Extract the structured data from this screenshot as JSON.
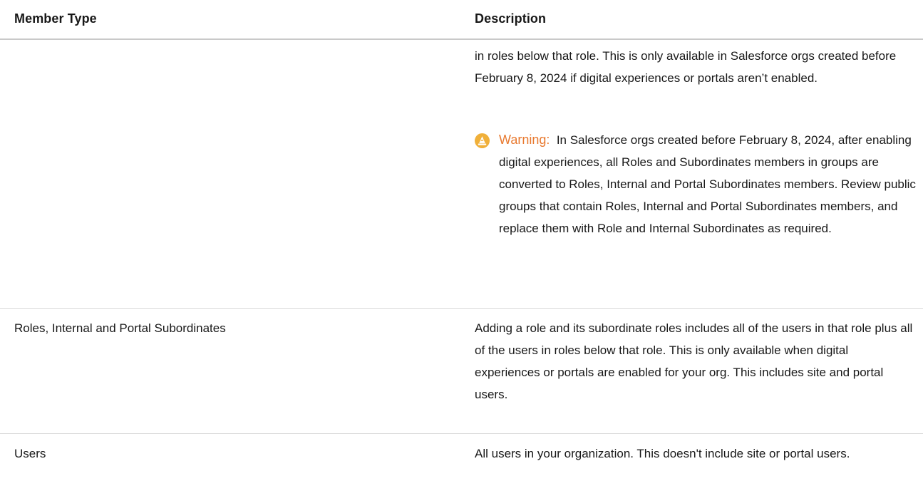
{
  "table": {
    "headers": {
      "member_type": "Member Type",
      "description": "Description"
    },
    "rows": [
      {
        "member_type": "",
        "description": "in roles below that role. This is only available in Salesforce orgs created before February 8, 2024 if digital experiences or portals aren’t enabled.",
        "warning": {
          "icon": "warning-icon",
          "label": "Warning:",
          "text": "In Salesforce orgs created before February 8, 2024, after enabling digital experiences, all Roles and Subordinates members in groups are converted to Roles, Internal and Portal Subordinates members. Review public groups that contain Roles, Internal and Portal Subordinates members, and replace them with Role and Internal Subordinates as required."
        }
      },
      {
        "member_type": "Roles, Internal and Portal Subordinates",
        "description": "Adding a role and its subordinate roles includes all of the users in that role plus all of the users in roles below that role. This is only available when digital experiences or portals are enabled for your org. This includes site and portal users."
      },
      {
        "member_type": "Users",
        "description": "All users in your organization. This doesn't include site or portal users."
      }
    ]
  },
  "colors": {
    "warning_label": "#e8792f",
    "warning_icon": "#f0b03a",
    "divider": "#d8d8d8",
    "text": "#181818"
  }
}
